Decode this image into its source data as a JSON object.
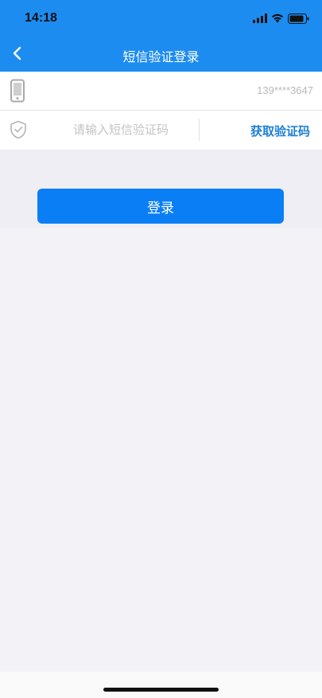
{
  "status_bar": {
    "time": "14:18",
    "icons": [
      "signal-icon",
      "wifi-icon",
      "battery-icon"
    ]
  },
  "nav": {
    "back_icon": "chevron-left-icon",
    "title": "短信验证登录"
  },
  "phone_row": {
    "icon": "phone-icon",
    "value": "139****3647"
  },
  "code_row": {
    "icon": "shield-check-icon",
    "input_value": "",
    "placeholder": "请输入短信验证码",
    "get_code_label": "获取验证码"
  },
  "login": {
    "label": "登录"
  },
  "colors": {
    "header": "#1d8cf0",
    "accent_text": "#1c7fd6",
    "button": "#0a7ff5",
    "background": "#f3f2f6"
  }
}
